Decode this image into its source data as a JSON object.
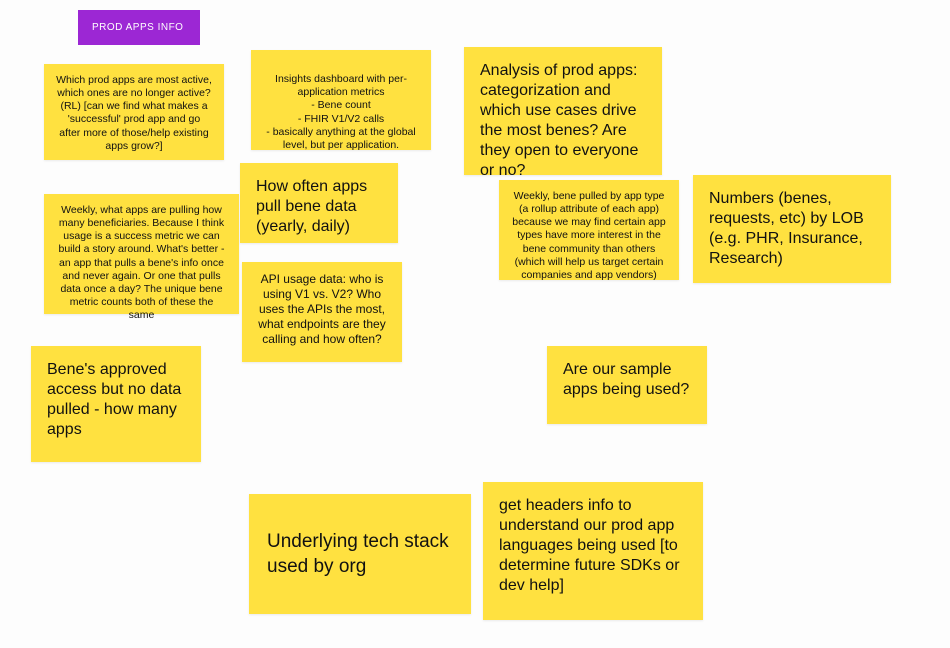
{
  "header": {
    "tab_label": "PROD APPS INFO"
  },
  "notes": {
    "n1": "Which prod apps are most active, which ones are no longer active? (RL) [can we find what makes a 'successful' prod app and go after more of those/help existing apps grow?]",
    "n2": "Insights dashboard with per-application metrics\n- Bene count\n- FHIR V1/V2 calls\n- basically anything at the global level, but per application.",
    "n3": "Analysis of prod apps: categorization and which use cases drive the most benes? Are they open to everyone or no?",
    "n4": "How often apps pull bene data (yearly, daily)",
    "n5": "Weekly, what apps are pulling how many beneficiaries. Because I think usage is a success metric we can build a story around. What's better - an app that pulls a bene's info once and never again. Or one that pulls data once a day?  The unique bene metric counts both of these the same",
    "n6": "Weekly, bene pulled by app type (a rollup attribute of each app) because we may find certain app types have more interest in the bene community than others (which will help us target certain companies and app vendors)",
    "n7": "Numbers (benes, requests, etc) by LOB (e.g. PHR, Insurance, Research)",
    "n8": "API usage data: who is using V1 vs. V2? Who uses the APIs the most, what endpoints are they calling and how often?",
    "n9": "Bene's approved access but no data pulled - how many apps",
    "n10": "Are our sample apps being used?",
    "n11": "Underlying tech stack used by org",
    "n12": "get headers info to understand our prod app languages being used [to determine future SDKs or dev help]"
  }
}
